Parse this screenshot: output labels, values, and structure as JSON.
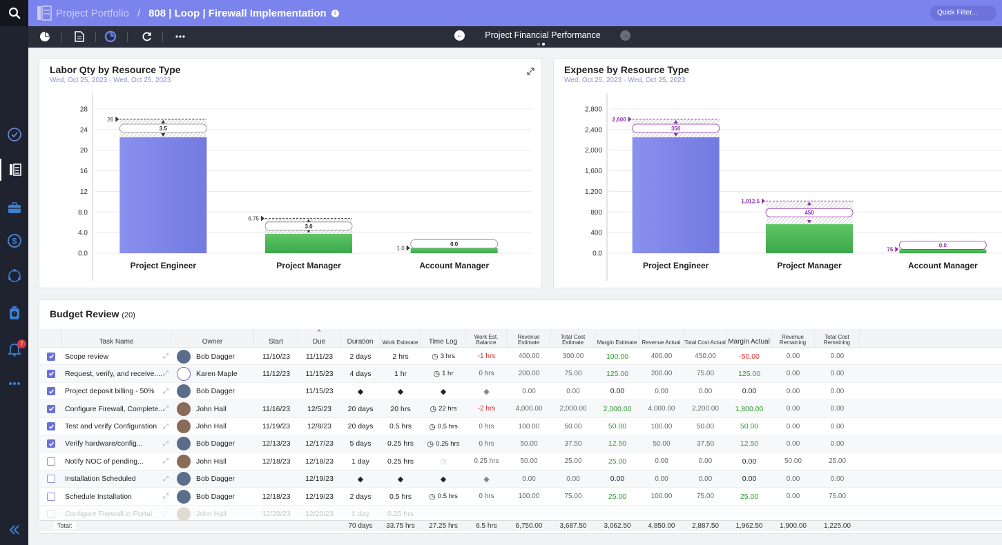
{
  "header": {
    "breadcrumb_root": "Project Portfolio",
    "breadcrumb_sep": "/",
    "project_title": "808 | Loop | Firewall Implementation",
    "quick_filter_placeholder": "Quick Filter..."
  },
  "toolbar": {
    "title": "Project Financial Performance",
    "icons": [
      "pie-chart-icon",
      "document-icon",
      "view-icon",
      "refresh-icon",
      "more-icon"
    ]
  },
  "rail": {
    "icons": [
      "search-icon",
      "check-circle-icon",
      "portfolio-icon",
      "briefcase-icon",
      "dollar-icon",
      "cycle-icon",
      "timer-icon",
      "bell-icon",
      "more-icon",
      "collapse-icon"
    ],
    "notification_count": "7"
  },
  "labor_chart": {
    "title": "Labor Qty by Resource Type",
    "date_range": "Wed, Oct 25, 2023  -  Wed, Oct 25, 2023"
  },
  "expense_chart": {
    "title": "Expense by Resource Type",
    "date_range": "Wed, Oct 25, 2023  -  Wed, Oct 25, 2023"
  },
  "chart_data": [
    {
      "type": "bar",
      "title": "Labor Qty by Resource Type",
      "categories": [
        "Project Engineer",
        "Project Manager",
        "Account Manager"
      ],
      "series": [
        {
          "values": [
            22.5,
            3.75,
            1.0
          ],
          "color": "#7b83ec"
        },
        {
          "values": [
            3.5,
            3.0,
            0.0
          ]
        }
      ],
      "target_labels": [
        "26",
        "6.75",
        "1.0"
      ],
      "remaining_labels": [
        "3.5",
        "3.0",
        "0.0"
      ],
      "ylim": [
        0,
        28
      ],
      "yticks": [
        "28",
        "24",
        "20",
        "16",
        "12",
        "8.0",
        "4.0",
        "0.0"
      ],
      "colors": [
        "#7b83ec",
        "#4cb85c"
      ],
      "grid": true
    },
    {
      "type": "bar",
      "title": "Expense by Resource Type",
      "categories": [
        "Project Engineer",
        "Project Manager",
        "Account Manager"
      ],
      "series": [
        {
          "values": [
            2250,
            562.5,
            75
          ]
        },
        {
          "values": [
            350,
            450,
            0.0
          ]
        }
      ],
      "target_labels": [
        "2,600",
        "1,012.5",
        "75"
      ],
      "remaining_labels": [
        "350",
        "450",
        "0.0"
      ],
      "ylim": [
        0,
        2800
      ],
      "yticks": [
        "2,800",
        "2,400",
        "2,000",
        "1,600",
        "1,200",
        "800",
        "400",
        "0.0"
      ],
      "colors": [
        "#7b83ec",
        "#4cb85c"
      ],
      "grid": true
    }
  ],
  "budget": {
    "title": "Budget Review",
    "count": "(20)",
    "columns": [
      "Task Name",
      "Owner",
      "Start",
      "Due",
      "Duration",
      "Work Estimate",
      "Time Log",
      "Work Est. Balance",
      "Revenue Estimate",
      "Total Cost Estimate",
      "Margin Estimate",
      "Revenue Actual",
      "Total Cost Actual",
      "Margin Actual",
      "Revenue Remaining",
      "Total Cost Remaining"
    ],
    "rows": [
      {
        "checked": true,
        "task": "Scope review",
        "owner": "Bob Dagger",
        "start": "11/10/23",
        "due": "11/11/23",
        "duration": "2 days",
        "work": "2 hrs",
        "timelog": "3 hrs",
        "balance": "-1 hrs",
        "rev_est": "400.00",
        "cost_est": "300.00",
        "margin_est": "100.00",
        "rev_act": "400.00",
        "cost_act": "450.00",
        "margin_act": "-50.00",
        "rev_rem": "0.00",
        "cost_rem": "0.00"
      },
      {
        "checked": true,
        "task": "Request, verify, and receive....",
        "owner": "Karen Maple",
        "start": "11/12/23",
        "due": "11/15/23",
        "duration": "4 days",
        "work": "1 hr",
        "timelog": "1 hr",
        "balance": "0 hrs",
        "rev_est": "200.00",
        "cost_est": "75.00",
        "margin_est": "125.00",
        "rev_act": "200.00",
        "cost_act": "75.00",
        "margin_act": "125.00",
        "rev_rem": "0.00",
        "cost_rem": "0.00"
      },
      {
        "checked": true,
        "task": "Project deposit billing - 50%",
        "owner": "Bob Dagger",
        "start": "",
        "due": "11/15/23",
        "duration": "◆",
        "work": "◆",
        "timelog": "◆",
        "balance": "◆",
        "rev_est": "0.00",
        "cost_est": "0.00",
        "margin_est": "0.00",
        "rev_act": "0.00",
        "cost_act": "0.00",
        "margin_act": "0.00",
        "rev_rem": "0.00",
        "cost_rem": "0.00"
      },
      {
        "checked": true,
        "task": "Configure Firewall, Complete...",
        "owner": "John Hall",
        "start": "11/16/23",
        "due": "12/5/23",
        "duration": "20 days",
        "work": "20 hrs",
        "timelog": "22 hrs",
        "balance": "-2 hrs",
        "rev_est": "4,000.00",
        "cost_est": "2,000.00",
        "margin_est": "2,000.00",
        "rev_act": "4,000.00",
        "cost_act": "2,200.00",
        "margin_act": "1,800.00",
        "rev_rem": "0.00",
        "cost_rem": "0.00"
      },
      {
        "checked": true,
        "task": "Test and verify Configuration",
        "owner": "John Hall",
        "start": "11/19/23",
        "due": "12/8/23",
        "duration": "20 days",
        "work": "0.5 hrs",
        "timelog": "0.5 hrs",
        "balance": "0 hrs",
        "rev_est": "100.00",
        "cost_est": "50.00",
        "margin_est": "50.00",
        "rev_act": "100.00",
        "cost_act": "50.00",
        "margin_act": "50.00",
        "rev_rem": "0.00",
        "cost_rem": "0.00"
      },
      {
        "checked": true,
        "task": "Verify hardware/config...",
        "owner": "Bob Dagger",
        "start": "12/13/23",
        "due": "12/17/23",
        "duration": "5 days",
        "work": "0.25 hrs",
        "timelog": "0.25 hrs",
        "balance": "0 hrs",
        "rev_est": "50.00",
        "cost_est": "37.50",
        "margin_est": "12.50",
        "rev_act": "50.00",
        "cost_act": "37.50",
        "margin_act": "12.50",
        "rev_rem": "0.00",
        "cost_rem": "0.00"
      },
      {
        "checked": false,
        "task": "Notify NOC of pending...",
        "owner": "John Hall",
        "start": "12/18/23",
        "due": "12/18/23",
        "duration": "1 day",
        "work": "0.25 hrs",
        "timelog": "",
        "balance": "0.25 hrs",
        "rev_est": "50.00",
        "cost_est": "25.00",
        "margin_est": "25.00",
        "rev_act": "0.00",
        "cost_act": "0.00",
        "margin_act": "0.00",
        "rev_rem": "50.00",
        "cost_rem": "25.00"
      },
      {
        "checked": false,
        "task": "Installation Scheduled",
        "owner": "Bob Dagger",
        "start": "",
        "due": "12/19/23",
        "duration": "◆",
        "work": "◆",
        "timelog": "◆",
        "balance": "◆",
        "rev_est": "0.00",
        "cost_est": "0.00",
        "margin_est": "0.00",
        "rev_act": "0.00",
        "cost_act": "0.00",
        "margin_act": "0.00",
        "rev_rem": "0.00",
        "cost_rem": "0.00"
      },
      {
        "checked": false,
        "task": "Schedule Installation",
        "owner": "Bob Dagger",
        "start": "12/18/23",
        "due": "12/19/23",
        "duration": "2 days",
        "work": "0.5 hrs",
        "timelog": "0.5 hrs",
        "balance": "0 hrs",
        "rev_est": "100.00",
        "cost_est": "75.00",
        "margin_est": "25.00",
        "rev_act": "100.00",
        "cost_act": "75.00",
        "margin_act": "25.00",
        "rev_rem": "0.00",
        "cost_rem": "75.00"
      },
      {
        "checked": false,
        "task": "Configure Firewall in Portal",
        "owner": "John Hall",
        "start": "12/20/23",
        "due": "12/20/23",
        "duration": "1 day",
        "work": "0.25 hrs",
        "timelog": "",
        "balance": "",
        "rev_est": "",
        "cost_est": "",
        "margin_est": "",
        "rev_act": "",
        "cost_act": "",
        "margin_act": "",
        "rev_rem": "",
        "cost_rem": ""
      }
    ],
    "totals": {
      "label": "Total:",
      "duration": "70 days",
      "work": "33.75 hrs",
      "timelog": "27.25 hrs",
      "balance": "6.5 hrs",
      "rev_est": "6,750.00",
      "cost_est": "3,687.50",
      "margin_est": "3,062.50",
      "rev_act": "4,850.00",
      "cost_act": "2,887.50",
      "margin_act": "1,962.50",
      "rev_rem": "1,900.00",
      "cost_rem": "1,225.00"
    }
  }
}
